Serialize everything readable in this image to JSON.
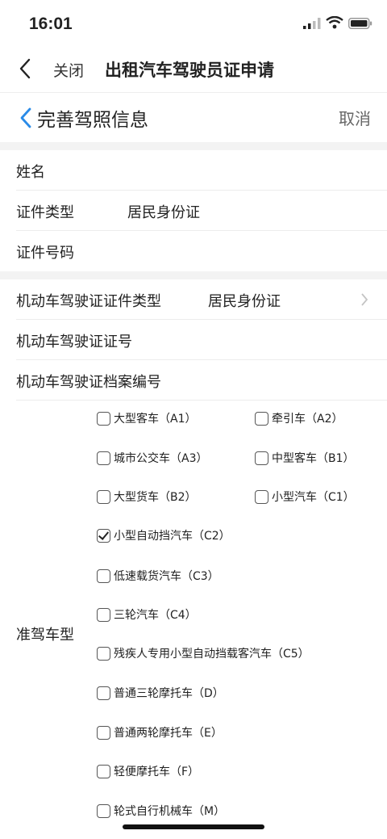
{
  "status": {
    "time": "16:01"
  },
  "nav": {
    "close": "关闭",
    "title": "出租汽车驾驶员证申请"
  },
  "sub": {
    "title": "完善驾照信息",
    "cancel": "取消"
  },
  "fields": {
    "name_label": "姓名",
    "id_type_label": "证件类型",
    "id_type_value": "居民身份证",
    "id_number_label": "证件号码",
    "dl_id_type_label": "机动车驾驶证证件类型",
    "dl_id_type_value": "居民身份证",
    "dl_number_label": "机动车驾驶证证号",
    "dl_archive_label": "机动车驾驶证档案编号"
  },
  "license": {
    "label": "准驾车型",
    "options": [
      {
        "label": "大型客车（A1）",
        "checked": false
      },
      {
        "label": "牵引车（A2）",
        "checked": false
      },
      {
        "label": "城市公交车（A3）",
        "checked": false
      },
      {
        "label": "中型客车（B1）",
        "checked": false
      },
      {
        "label": "大型货车（B2）",
        "checked": false
      },
      {
        "label": "小型汽车（C1）",
        "checked": false
      },
      {
        "label": "小型自动挡汽车（C2）",
        "checked": true
      },
      {
        "label": "低速载货汽车（C3）",
        "checked": false
      },
      {
        "label": "三轮汽车（C4）",
        "checked": false
      },
      {
        "label": "残疾人专用小型自动挡载客汽车（C5）",
        "checked": false
      },
      {
        "label": "普通三轮摩托车（D）",
        "checked": false
      },
      {
        "label": "普通两轮摩托车（E）",
        "checked": false
      },
      {
        "label": "轻便摩托车（F）",
        "checked": false
      },
      {
        "label": "轮式自行机械车（M）",
        "checked": false
      }
    ]
  },
  "colors": {
    "accent": "#2a8be8",
    "gap": "#f3f3f3"
  }
}
